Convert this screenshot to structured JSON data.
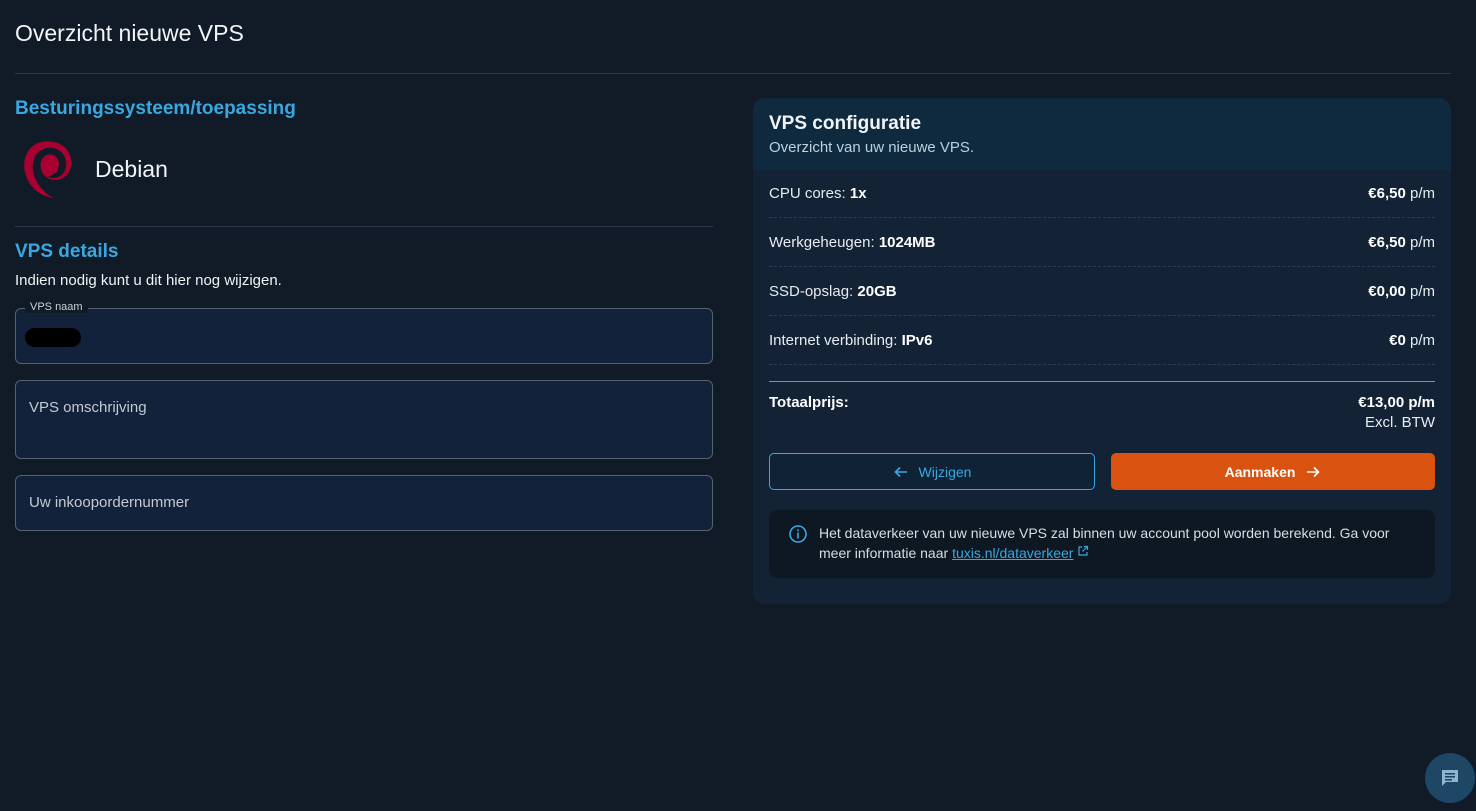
{
  "page": {
    "title": "Overzicht nieuwe VPS"
  },
  "os": {
    "heading": "Besturingssysteem/toepassing",
    "name": "Debian",
    "logo_icon": "debian-logo",
    "logo_color": "#a80030"
  },
  "details": {
    "heading": "VPS details",
    "subtitle": "Indien nodig kunt u dit hier nog wijzigen.",
    "name_label": "VPS naam",
    "name_value": "",
    "description_placeholder": "VPS omschrijving",
    "po_placeholder": "Uw inkoopordernummer"
  },
  "config": {
    "title": "VPS configuratie",
    "subtitle": "Overzicht van uw nieuwe VPS.",
    "rows": [
      {
        "label": "CPU cores:",
        "value": "1x",
        "price": "€6,50",
        "period": "p/m"
      },
      {
        "label": "Werkgeheugen:",
        "value": "1024MB",
        "price": "€6,50",
        "period": "p/m"
      },
      {
        "label": "SSD-opslag:",
        "value": "20GB",
        "price": "€0,00",
        "period": "p/m"
      },
      {
        "label": "Internet verbinding:",
        "value": "IPv6",
        "price": "€0",
        "period": "p/m"
      }
    ],
    "total_label": "Totaalprijs:",
    "total_price": "€13,00 p/m",
    "total_vat": "Excl. BTW",
    "back_button": "Wijzigen",
    "create_button": "Aanmaken",
    "notice_text": "Het dataverkeer van uw nieuwe VPS zal binnen uw account pool worden berekend. Ga voor meer informatie naar ",
    "notice_link": "tuxis.nl/dataverkeer"
  },
  "colors": {
    "background": "#111a27",
    "accent": "#3aa8e0",
    "primary_button": "#d9520f"
  },
  "icons": {
    "back": "arrow-left-icon",
    "create": "arrow-right-icon",
    "info": "info-icon",
    "external": "external-link-icon",
    "chat": "chat-icon"
  }
}
